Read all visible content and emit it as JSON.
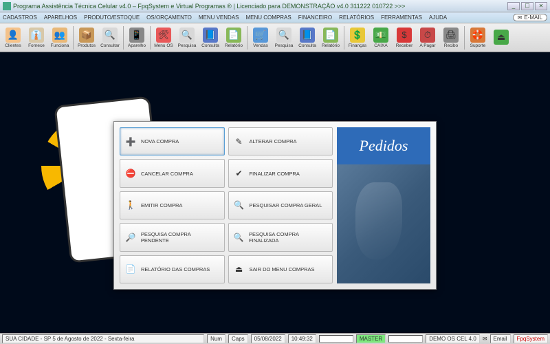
{
  "titlebar": {
    "text": "Programa Assistência Técnica Celular v4.0 – FpqSystem e Virtual Programas ® | Licenciado para  DEMONSTRAÇÃO v4.0 311222 010722 >>>"
  },
  "menubar": {
    "items": [
      "CADASTROS",
      "APARELHOS",
      "PRODUTO/ESTOQUE",
      "OS/ORÇAMENTO",
      "MENU VENDAS",
      "MENU COMPRAS",
      "FINANCEIRO",
      "RELATÓRIOS",
      "FERRAMENTAS",
      "AJUDA"
    ],
    "email": "E-MAIL"
  },
  "toolbar": {
    "groups": [
      [
        {
          "label": "Clientes",
          "icon": "👤",
          "bg": "#f4c28a"
        },
        {
          "label": "Fornece",
          "icon": "👔",
          "bg": "#d8c8a8"
        },
        {
          "label": "Funciona",
          "icon": "👥",
          "bg": "#e8b878"
        }
      ],
      [
        {
          "label": "Produtos",
          "icon": "📦",
          "bg": "#c89858"
        },
        {
          "label": "Consultar",
          "icon": "🔍",
          "bg": "#d8d8d8"
        }
      ],
      [
        {
          "label": "Aparelho",
          "icon": "📱",
          "bg": "#888"
        }
      ],
      [
        {
          "label": "Menu OS",
          "icon": "🛠",
          "bg": "#e85858"
        },
        {
          "label": "Pesquisa",
          "icon": "🔍",
          "bg": "#d8d8d8"
        },
        {
          "label": "Consulta",
          "icon": "📘",
          "bg": "#5878c8"
        },
        {
          "label": "Relatório",
          "icon": "📄",
          "bg": "#88b858"
        }
      ],
      [
        {
          "label": "Vendas",
          "icon": "🛒",
          "bg": "#5898d8"
        },
        {
          "label": "Pesquisa",
          "icon": "🔍",
          "bg": "#d8d8d8"
        },
        {
          "label": "Consulta",
          "icon": "📘",
          "bg": "#5878c8"
        },
        {
          "label": "Relatório",
          "icon": "📄",
          "bg": "#88b858"
        }
      ],
      [
        {
          "label": "Finanças",
          "icon": "💲",
          "bg": "#e8c838"
        },
        {
          "label": "CAIXA",
          "icon": "💵",
          "bg": "#48a848"
        },
        {
          "label": "Receber",
          "icon": "$",
          "bg": "#d83838"
        },
        {
          "label": "A Pagar",
          "icon": "⏱",
          "bg": "#c84848"
        },
        {
          "label": "Recibo",
          "icon": "🖨",
          "bg": "#888"
        }
      ],
      [
        {
          "label": "Suporte",
          "icon": "🛟",
          "bg": "#d87838"
        },
        {
          "label": "",
          "icon": "⏏",
          "bg": "#48a848"
        }
      ]
    ]
  },
  "dialog": {
    "sideTitle": "Pedidos",
    "buttons": [
      {
        "label": "NOVA COMPRA",
        "icon": "➕",
        "selected": true
      },
      {
        "label": "ALTERAR COMPRA",
        "icon": "✎",
        "selected": false
      },
      {
        "label": "CANCELAR COMPRA",
        "icon": "⛔",
        "selected": false
      },
      {
        "label": "FINALIZAR COMPRA",
        "icon": "✔",
        "selected": false
      },
      {
        "label": "EMITIR COMPRA",
        "icon": "🚶",
        "selected": false
      },
      {
        "label": "PESQUISAR COMPRA GERAL",
        "icon": "🔍",
        "selected": false
      },
      {
        "label": "PESQUISA COMPRA PENDENTE",
        "icon": "🔎",
        "selected": false
      },
      {
        "label": "PESQUISA COMPRA FINALIZADA",
        "icon": "🔍",
        "selected": false
      },
      {
        "label": "RELATÓRIO DAS COMPRAS",
        "icon": "📄",
        "selected": false
      },
      {
        "label": "SAIR DO MENU COMPRAS",
        "icon": "⏏",
        "selected": false
      }
    ]
  },
  "statusbar": {
    "left": "SUA CIDADE - SP  5 de Agosto de 2022 - Sexta-feira",
    "num": "Num",
    "caps": "Caps",
    "date": "05/08/2022",
    "time": "10:49:32",
    "master": "MASTER",
    "demo": "DEMO OS CEL 4.0",
    "email": "Email",
    "brand": "FpqSystem"
  }
}
